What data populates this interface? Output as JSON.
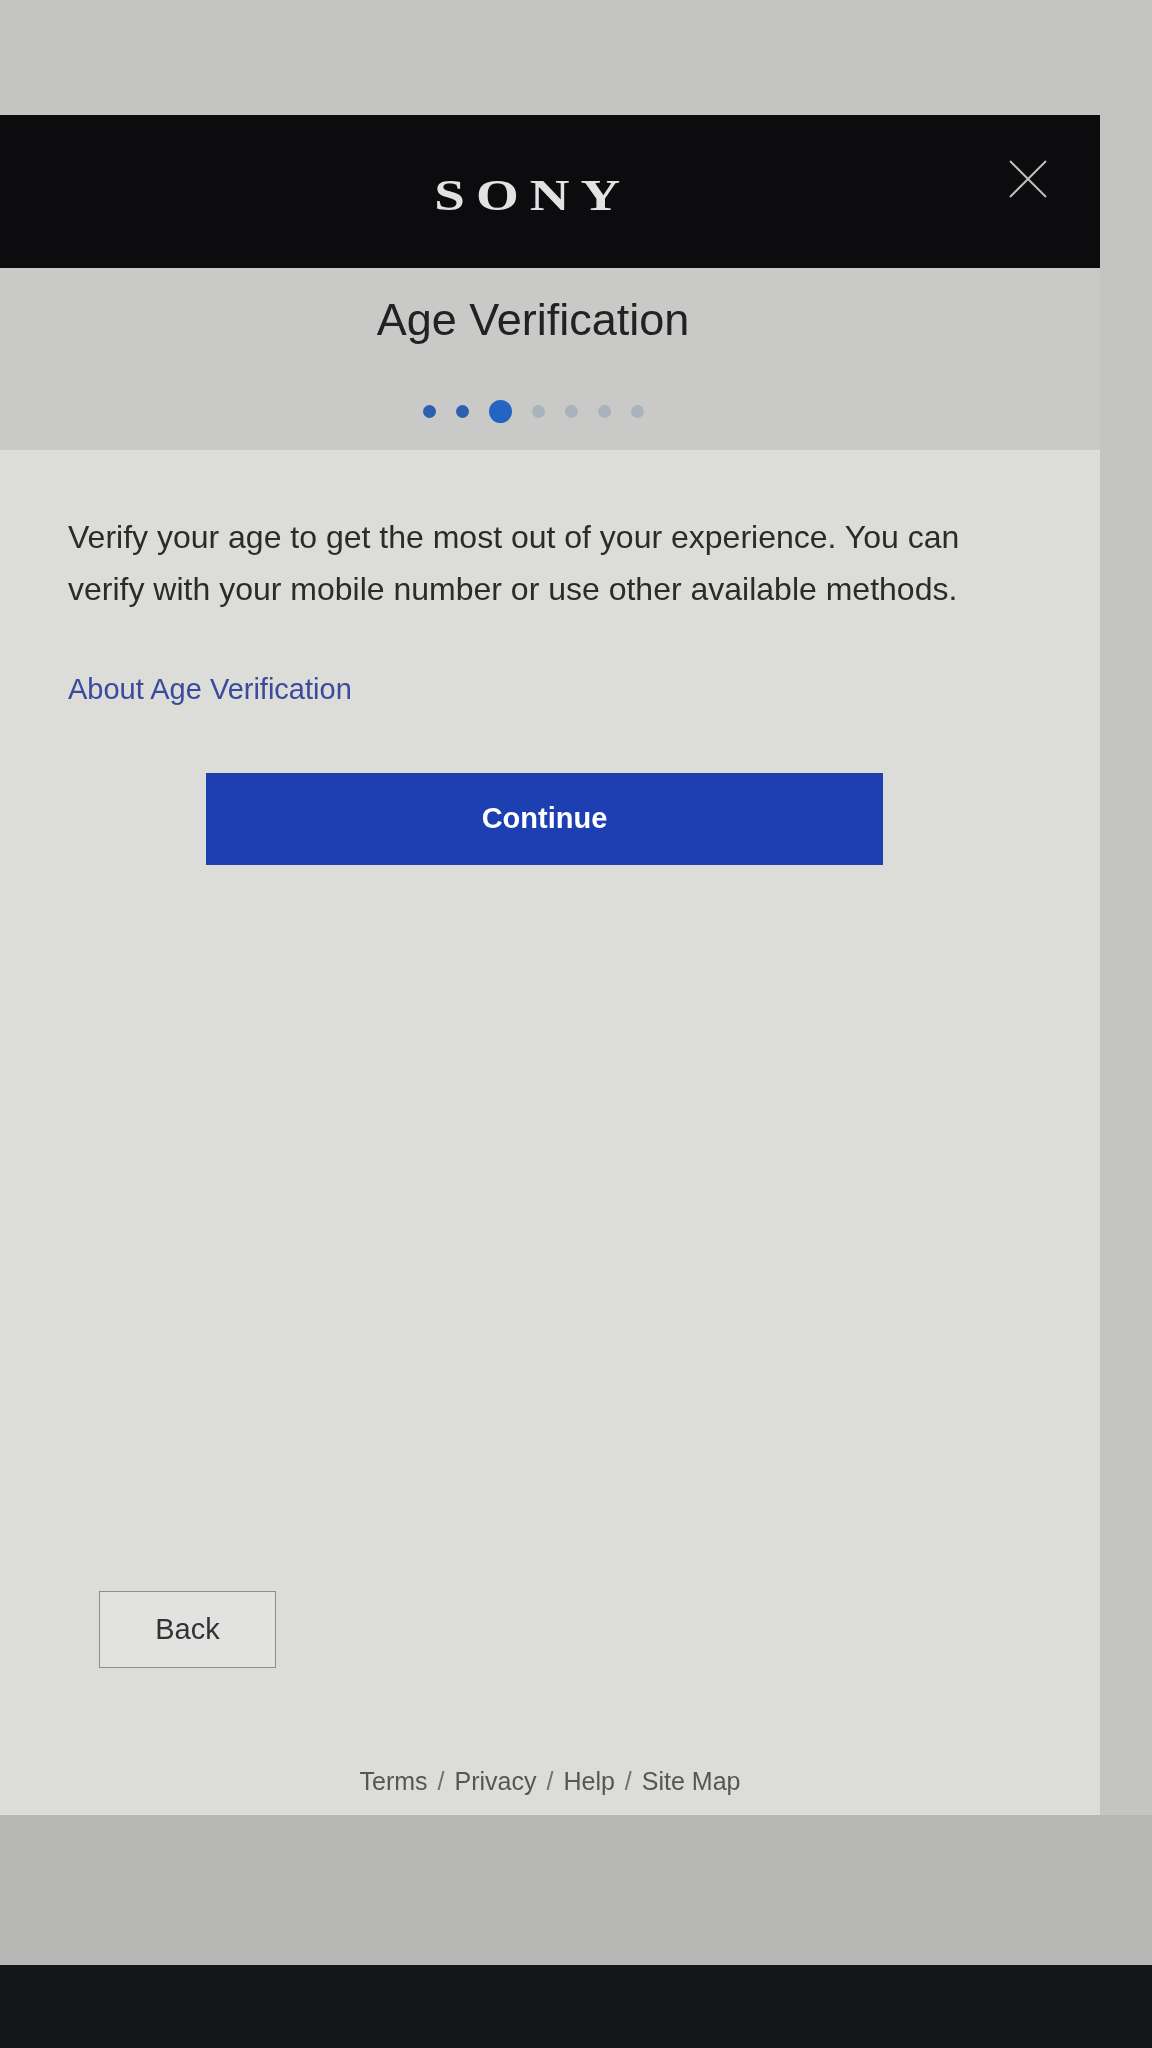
{
  "header": {
    "logo": "SONY"
  },
  "title": "Age Verification",
  "steps": [
    {
      "completed": true,
      "selected": false
    },
    {
      "completed": true,
      "selected": false
    },
    {
      "completed": false,
      "selected": true
    },
    {
      "completed": false,
      "selected": false
    },
    {
      "completed": false,
      "selected": false
    },
    {
      "completed": false,
      "selected": false
    },
    {
      "completed": false,
      "selected": false
    }
  ],
  "description": "Verify your age to get the most out of your experience. You can verify with your mobile number or use other available methods.",
  "about_link": "About Age Verification",
  "continue_button": "Continue",
  "back_button": "Back",
  "footer_links": [
    {
      "kind": "link",
      "text": "Terms"
    },
    {
      "kind": "separator",
      "text": "/"
    },
    {
      "kind": "link",
      "text": "Privacy"
    },
    {
      "kind": "separator",
      "text": "/"
    },
    {
      "kind": "link",
      "text": "Help"
    },
    {
      "kind": "separator",
      "text": "/"
    },
    {
      "kind": "link",
      "text": "Site Map"
    }
  ]
}
